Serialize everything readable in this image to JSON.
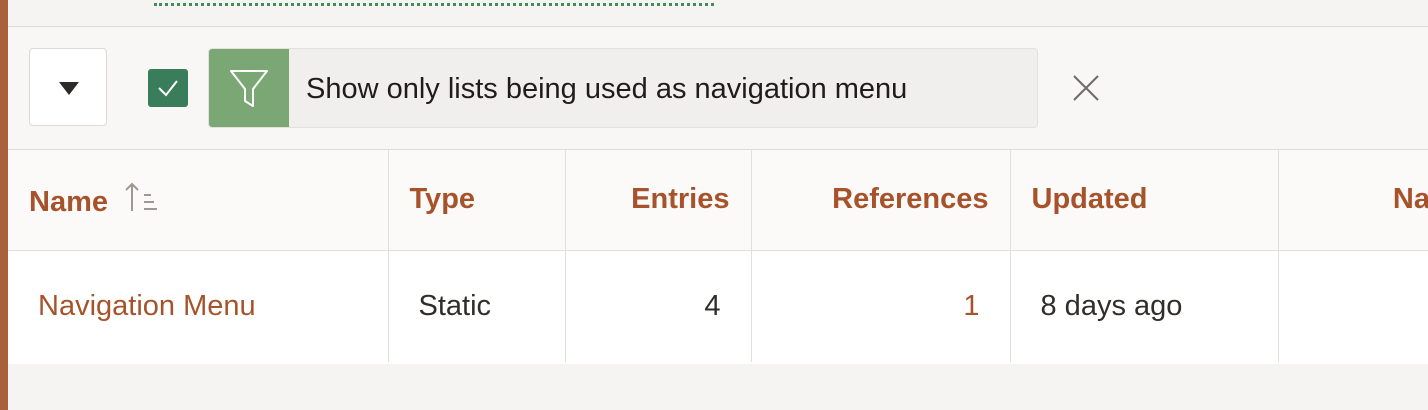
{
  "toolbar": {
    "filter_label": "Show only lists being used as navigation menu",
    "filter_checked": true,
    "icons": {
      "dropdown": "chevron-down-icon",
      "checkbox": "check-icon",
      "filter": "filter-funnel-icon",
      "remove": "close-icon"
    }
  },
  "table": {
    "columns": [
      {
        "label": "Name",
        "sort": "ascending"
      },
      {
        "label": "Type"
      },
      {
        "label": "Entries"
      },
      {
        "label": "References"
      },
      {
        "label": "Updated"
      },
      {
        "label": "Naviga"
      }
    ],
    "rows": [
      {
        "name": "Navigation Menu",
        "type": "Static",
        "entries": "4",
        "references": "1",
        "updated": "8 days ago",
        "navigation": ""
      }
    ]
  },
  "colors": {
    "accent": "#a6532c",
    "check_green": "#3a7d5a",
    "filter_green": "#7aa773"
  }
}
